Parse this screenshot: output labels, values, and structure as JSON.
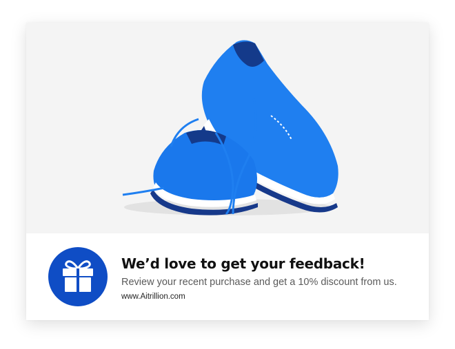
{
  "hero": {
    "image_icon": "running-shoes-image"
  },
  "badge": {
    "icon": "gift-icon",
    "color": "#0f4dc5"
  },
  "message": {
    "title": "We’d love to get your feedback!",
    "subtitle": "Review your recent purchase and get a 10% discount from us.",
    "url": "www.Aitrillion.com"
  }
}
